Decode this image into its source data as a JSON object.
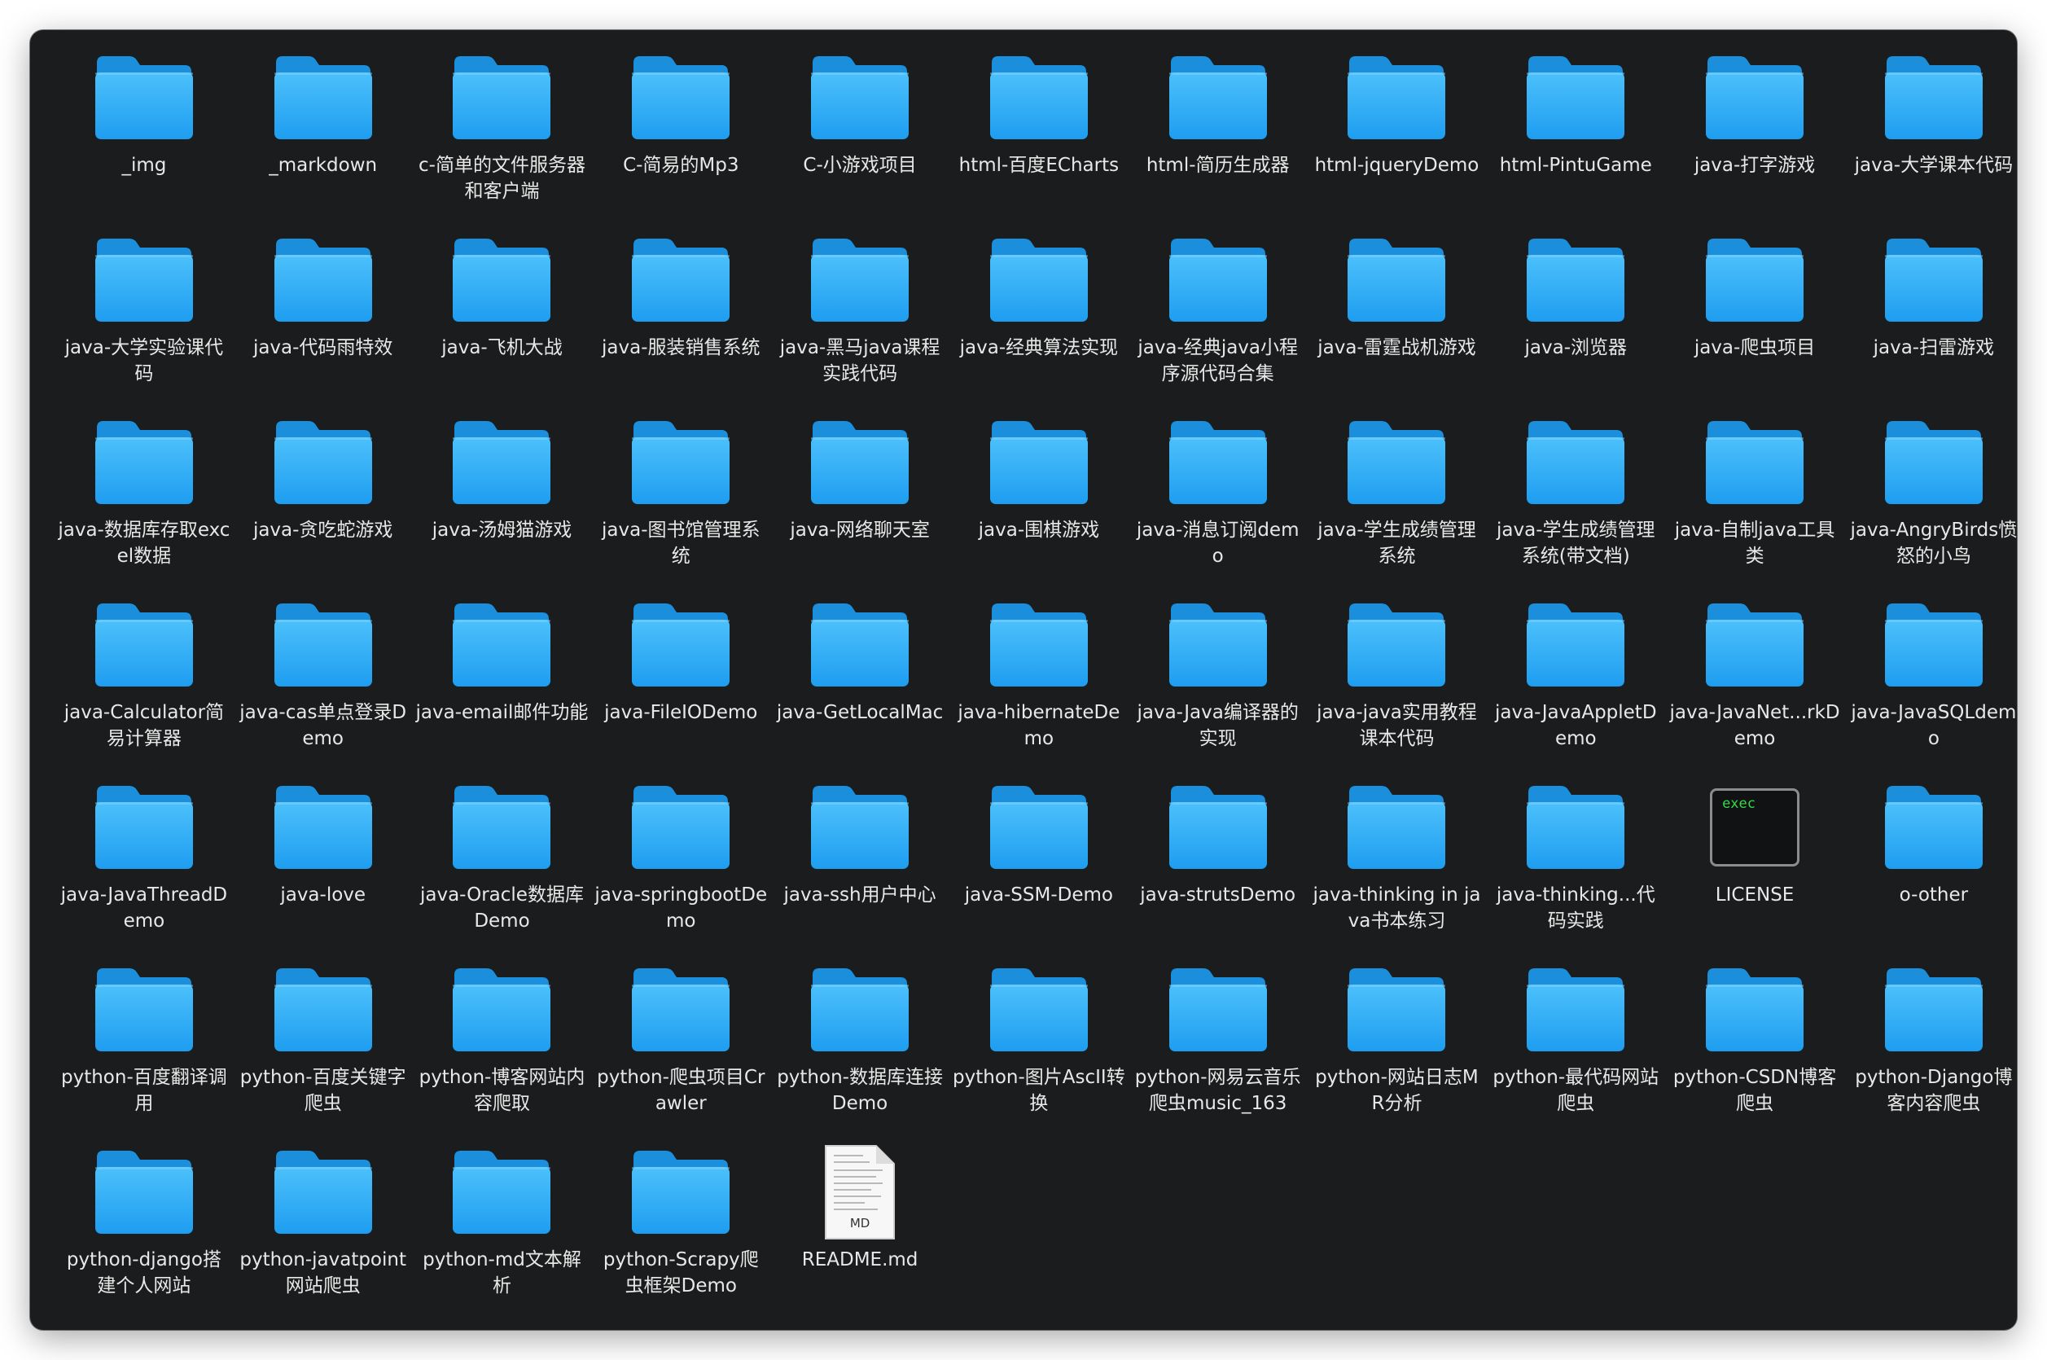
{
  "window": {
    "background": "#1b1c1d",
    "folder_color": "#29a9f4"
  },
  "items": [
    {
      "label": "_img",
      "icon": "folder-icon"
    },
    {
      "label": "_markdown",
      "icon": "folder-icon"
    },
    {
      "label": "c-简单的文件服务器和客户端",
      "icon": "folder-icon"
    },
    {
      "label": "C-简易的Mp3",
      "icon": "folder-icon"
    },
    {
      "label": "C-小游戏项目",
      "icon": "folder-icon"
    },
    {
      "label": "html-百度ECharts",
      "icon": "folder-icon"
    },
    {
      "label": "html-简历生成器",
      "icon": "folder-icon"
    },
    {
      "label": "html-jqueryDemo",
      "icon": "folder-icon"
    },
    {
      "label": "html-PintuGame",
      "icon": "folder-icon"
    },
    {
      "label": "java-打字游戏",
      "icon": "folder-icon"
    },
    {
      "label": "java-大学课本代码",
      "icon": "folder-icon"
    },
    {
      "label": "java-大学实验课代码",
      "icon": "folder-icon"
    },
    {
      "label": "java-代码雨特效",
      "icon": "folder-icon"
    },
    {
      "label": "java-飞机大战",
      "icon": "folder-icon"
    },
    {
      "label": "java-服装销售系统",
      "icon": "folder-icon"
    },
    {
      "label": "java-黑马java课程实践代码",
      "icon": "folder-icon"
    },
    {
      "label": "java-经典算法实现",
      "icon": "folder-icon"
    },
    {
      "label": "java-经典java小程序源代码合集",
      "icon": "folder-icon"
    },
    {
      "label": "java-雷霆战机游戏",
      "icon": "folder-icon"
    },
    {
      "label": "java-浏览器",
      "icon": "folder-icon"
    },
    {
      "label": "java-爬虫项目",
      "icon": "folder-icon"
    },
    {
      "label": "java-扫雷游戏",
      "icon": "folder-icon"
    },
    {
      "label": "java-数据库存取excel数据",
      "icon": "folder-icon"
    },
    {
      "label": "java-贪吃蛇游戏",
      "icon": "folder-icon"
    },
    {
      "label": "java-汤姆猫游戏",
      "icon": "folder-icon"
    },
    {
      "label": "java-图书馆管理系统",
      "icon": "folder-icon"
    },
    {
      "label": "java-网络聊天室",
      "icon": "folder-icon"
    },
    {
      "label": "java-围棋游戏",
      "icon": "folder-icon"
    },
    {
      "label": "java-消息订阅demo",
      "icon": "folder-icon"
    },
    {
      "label": "java-学生成绩管理系统",
      "icon": "folder-icon"
    },
    {
      "label": "java-学生成绩管理系统(带文档)",
      "icon": "folder-icon"
    },
    {
      "label": "java-自制java工具类",
      "icon": "folder-icon"
    },
    {
      "label": "java-AngryBirds愤怒的小鸟",
      "icon": "folder-icon"
    },
    {
      "label": "java-Calculator简易计算器",
      "icon": "folder-icon"
    },
    {
      "label": "java-cas单点登录Demo",
      "icon": "folder-icon"
    },
    {
      "label": "java-email邮件功能",
      "icon": "folder-icon"
    },
    {
      "label": "java-FileIODemo",
      "icon": "folder-icon"
    },
    {
      "label": "java-GetLocalMac",
      "icon": "folder-icon"
    },
    {
      "label": "java-hibernateDemo",
      "icon": "folder-icon"
    },
    {
      "label": "java-Java编译器的实现",
      "icon": "folder-icon"
    },
    {
      "label": "java-java实用教程课本代码",
      "icon": "folder-icon"
    },
    {
      "label": "java-JavaAppletDemo",
      "icon": "folder-icon"
    },
    {
      "label": "java-JavaNet...rkDemo",
      "icon": "folder-icon"
    },
    {
      "label": "java-JavaSQLdemo",
      "icon": "folder-icon"
    },
    {
      "label": "java-JavaThreadDemo",
      "icon": "folder-icon"
    },
    {
      "label": "java-love",
      "icon": "folder-icon"
    },
    {
      "label": "java-Oracle数据库Demo",
      "icon": "folder-icon"
    },
    {
      "label": "java-springbootDemo",
      "icon": "folder-icon"
    },
    {
      "label": "java-ssh用户中心",
      "icon": "folder-icon"
    },
    {
      "label": "java-SSM-Demo",
      "icon": "folder-icon"
    },
    {
      "label": "java-strutsDemo",
      "icon": "folder-icon"
    },
    {
      "label": "java-thinking in java书本练习",
      "icon": "folder-icon"
    },
    {
      "label": "java-thinking...代码实践",
      "icon": "folder-icon"
    },
    {
      "label": "LICENSE",
      "icon": "exec-file-icon",
      "badge": "exec"
    },
    {
      "label": "o-other",
      "icon": "folder-icon"
    },
    {
      "label": "python-百度翻译调用",
      "icon": "folder-icon"
    },
    {
      "label": "python-百度关键字爬虫",
      "icon": "folder-icon"
    },
    {
      "label": "python-博客网站内容爬取",
      "icon": "folder-icon"
    },
    {
      "label": "python-爬虫项目Crawler",
      "icon": "folder-icon"
    },
    {
      "label": "python-数据库连接Demo",
      "icon": "folder-icon"
    },
    {
      "label": "python-图片AscII转换",
      "icon": "folder-icon"
    },
    {
      "label": "python-网易云音乐爬虫music_163",
      "icon": "folder-icon"
    },
    {
      "label": "python-网站日志MR分析",
      "icon": "folder-icon"
    },
    {
      "label": "python-最代码网站爬虫",
      "icon": "folder-icon"
    },
    {
      "label": "python-CSDN博客爬虫",
      "icon": "folder-icon"
    },
    {
      "label": "python-Django博客内容爬虫",
      "icon": "folder-icon"
    },
    {
      "label": "python-django搭建个人网站",
      "icon": "folder-icon"
    },
    {
      "label": "python-javatpoint网站爬虫",
      "icon": "folder-icon"
    },
    {
      "label": "python-md文本解析",
      "icon": "folder-icon"
    },
    {
      "label": "python-Scrapy爬虫框架Demo",
      "icon": "folder-icon"
    },
    {
      "label": "README.md",
      "icon": "markdown-file-icon",
      "badge": "MD"
    }
  ]
}
